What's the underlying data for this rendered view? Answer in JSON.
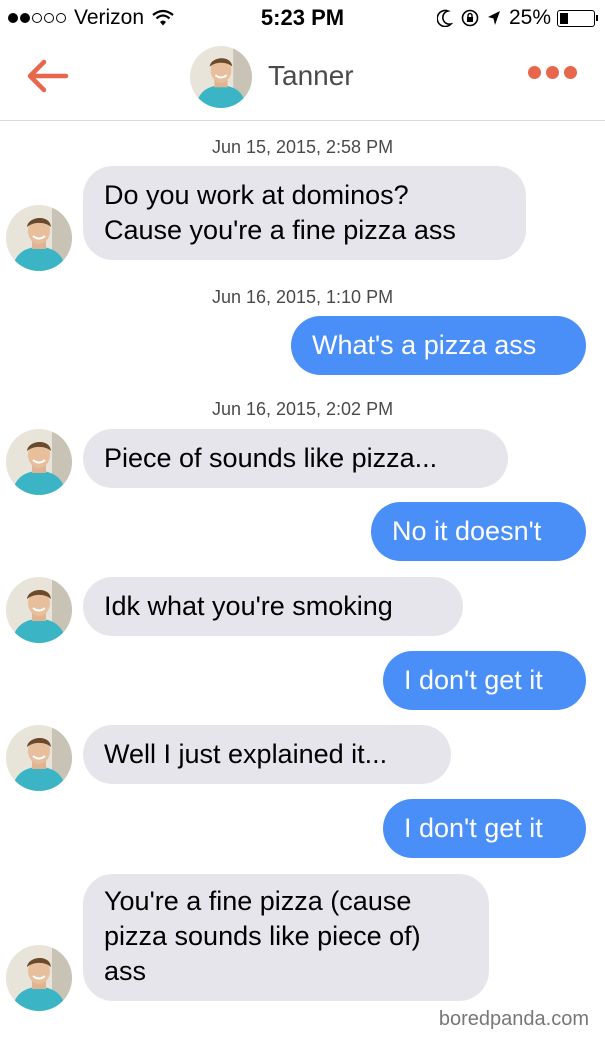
{
  "status_bar": {
    "carrier": "Verizon",
    "time": "5:23 PM",
    "battery": "25%",
    "signal_bars_filled": 2,
    "signal_bars_total": 5
  },
  "header": {
    "contact_name": "Tanner",
    "back_icon": "arrow-left-icon",
    "menu_icon": "more-dots-icon",
    "accent_color": "#e7664c"
  },
  "messages": [
    {
      "type": "timestamp",
      "text": "Jun 15, 2015, 2:58 PM"
    },
    {
      "type": "incoming",
      "lines": [
        "Do you work at dominos?",
        "Cause you're a fine pizza ass"
      ]
    },
    {
      "type": "timestamp",
      "text": "Jun 16, 2015, 1:10 PM"
    },
    {
      "type": "outgoing",
      "lines": [
        "What's a pizza ass"
      ]
    },
    {
      "type": "timestamp",
      "text": "Jun 16, 2015, 2:02 PM"
    },
    {
      "type": "incoming",
      "lines": [
        "Piece of sounds like pizza..."
      ]
    },
    {
      "type": "outgoing",
      "lines": [
        "No it doesn't"
      ]
    },
    {
      "type": "incoming",
      "lines": [
        "Idk what you're smoking"
      ]
    },
    {
      "type": "outgoing",
      "lines": [
        "I don't get it"
      ]
    },
    {
      "type": "incoming",
      "lines": [
        "Well I just explained it..."
      ]
    },
    {
      "type": "outgoing",
      "lines": [
        "I don't get it"
      ]
    },
    {
      "type": "incoming",
      "lines": [
        "You're a fine pizza (cause",
        "pizza sounds like piece of)",
        "ass"
      ]
    }
  ],
  "colors": {
    "incoming_bubble": "#e6e5eb",
    "outgoing_bubble": "#4a8ff7"
  },
  "watermark": "boredpanda.com"
}
